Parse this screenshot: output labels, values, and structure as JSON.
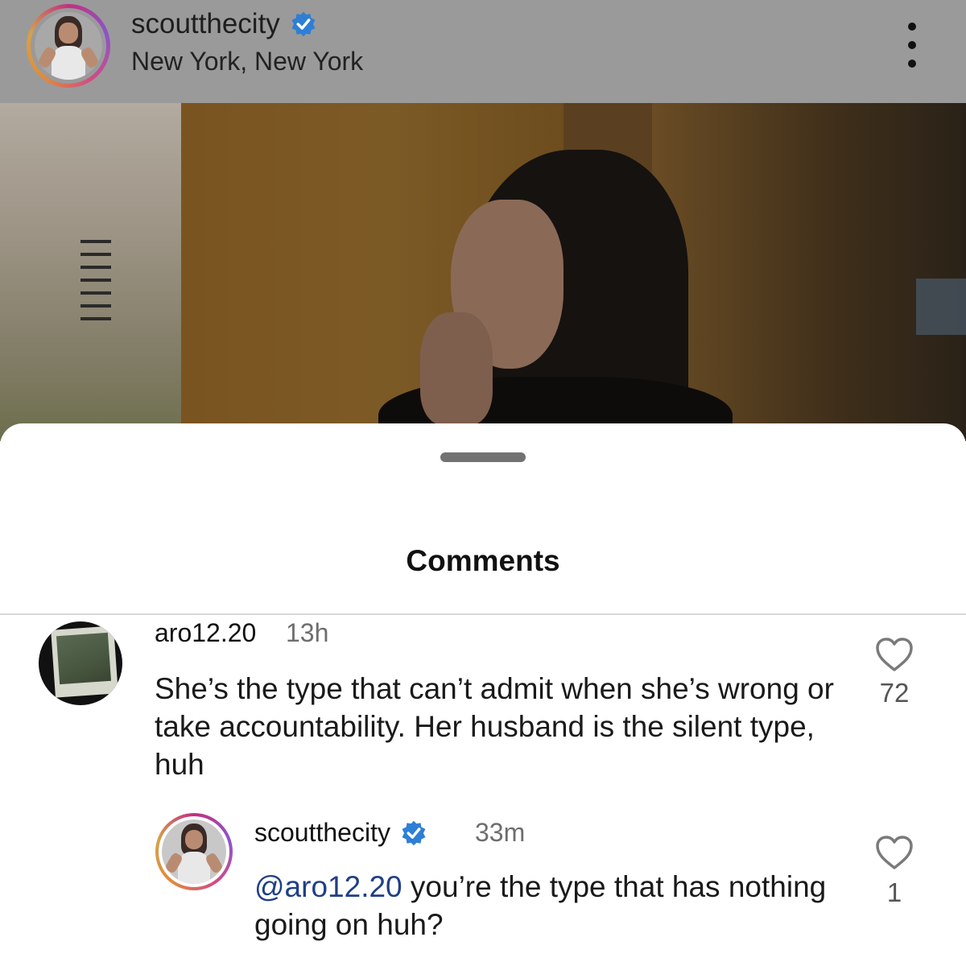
{
  "post": {
    "username": "scoutthecity",
    "location": "New York, New York"
  },
  "sheet": {
    "title": "Comments"
  },
  "comments": [
    {
      "username": "aro12.20",
      "time": "13h",
      "text": "She’s the type that can’t admit when she’s wrong or take accountability.  Her husband is the silent type, huh",
      "likes": "72",
      "reply": {
        "username": "scoutthecity",
        "time": "33m",
        "mention": "@aro12.20",
        "text": " you’re the type that has nothing going on huh?",
        "likes": "1"
      }
    }
  ],
  "colors": {
    "verified": "#2d7fd6",
    "mention": "#1f3f86",
    "header_dim": "#9a9a9a"
  },
  "icons": {
    "verified": "verified-badge-icon",
    "more": "more-vertical-icon",
    "like": "heart-outline-icon"
  }
}
